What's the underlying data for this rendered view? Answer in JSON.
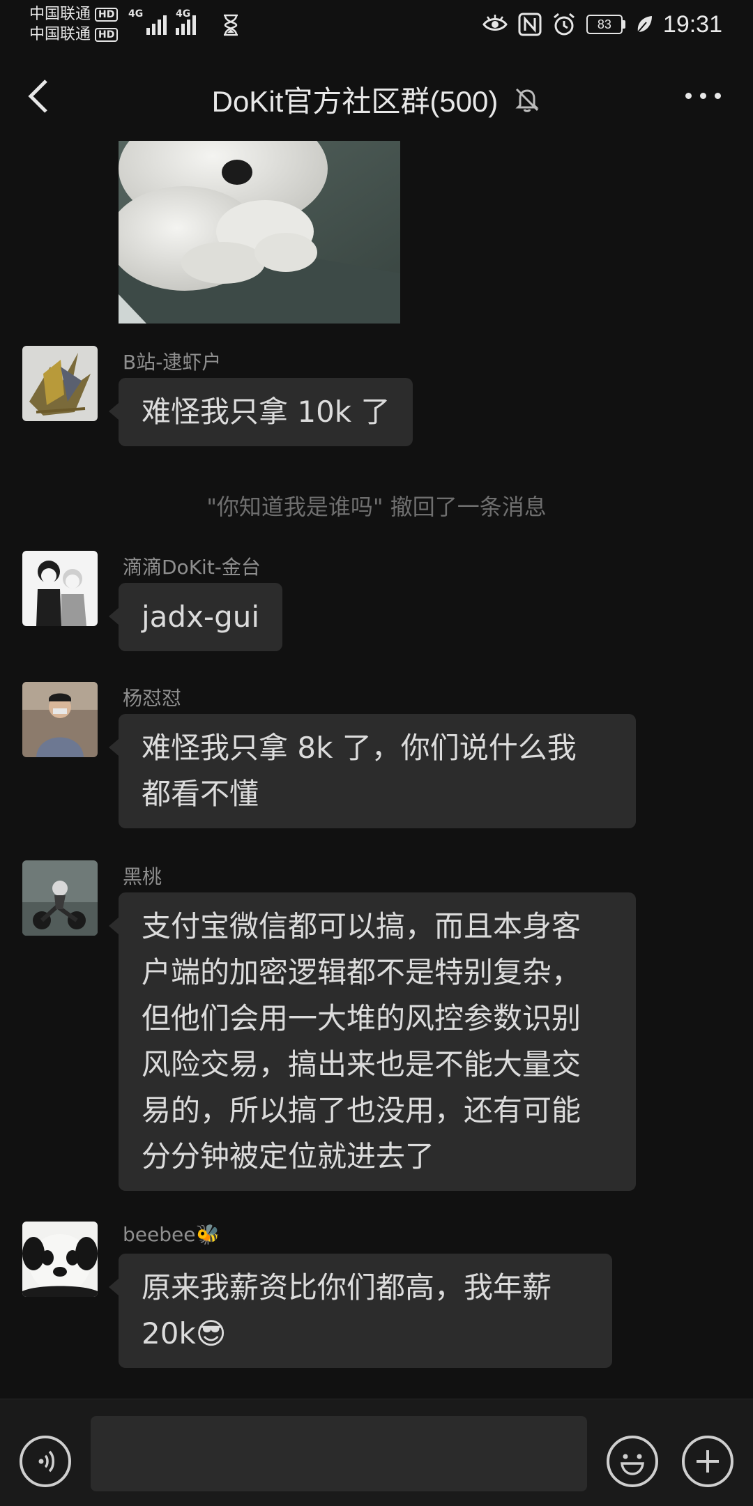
{
  "status_bar": {
    "carrier_1": "中国联通",
    "carrier_2": "中国联通",
    "hd_label": "HD",
    "network_1": "4G",
    "network_2": "4G",
    "battery_level": "83",
    "time": "19:31",
    "icons": [
      "eye-icon",
      "nfc-icon",
      "alarm-icon",
      "battery-icon",
      "leaf-icon",
      "hourglass-icon"
    ]
  },
  "header": {
    "title": "DoKit官方社区群(500)",
    "back_icon": "chevron-left-icon",
    "mute_icon": "bell-off-icon",
    "more_icon": "more-dots-icon"
  },
  "messages": [
    {
      "sender": "B站-逮虾户",
      "lines": [
        "难怪我只拿 10k 了"
      ]
    },
    {
      "system": "\"你知道我是谁吗\" 撤回了一条消息"
    },
    {
      "sender": "滴滴DoKit-金台",
      "lines": [
        "jadx-gui"
      ]
    },
    {
      "sender": "杨怼怼",
      "lines": [
        "难怪我只拿 8k 了，你们说什么我",
        "都看不懂"
      ]
    },
    {
      "sender": "黑桃",
      "lines": [
        "支付宝微信都可以搞，而且本身客",
        "户端的加密逻辑都不是特别复杂，",
        "但他们会用一大堆的风控参数识别",
        "风险交易，搞出来也是不能大量交",
        "易的，所以搞了也没用，还有可能",
        "分分钟被定位就进去了"
      ]
    },
    {
      "sender": "beebee🐝",
      "lines": [
        "原来我薪资比你们都高，我年薪",
        "20k😎"
      ]
    }
  ],
  "input_bar": {
    "voice_icon": "voice-icon",
    "text_value": "",
    "emoji_icon": "emoji-icon",
    "plus_icon": "plus-icon"
  }
}
